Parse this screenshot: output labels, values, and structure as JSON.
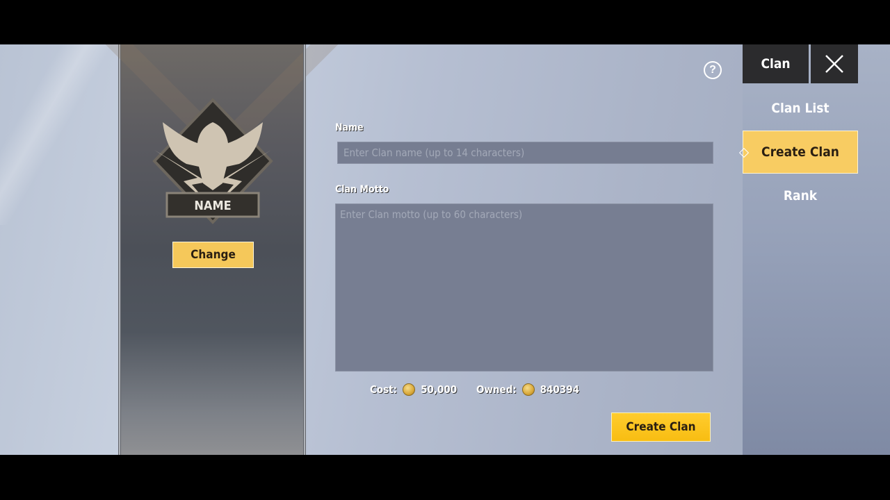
{
  "emblem": {
    "name_plate": "NAME",
    "change_label": "Change"
  },
  "form": {
    "name_label": "Name",
    "name_placeholder": "Enter Clan name (up to 14 characters)",
    "name_value": "",
    "motto_label": "Clan Motto",
    "motto_placeholder": "Enter Clan motto (up to 60 characters)",
    "motto_value": ""
  },
  "cost": {
    "cost_label": "Cost:",
    "cost_value": "50,000",
    "owned_label": "Owned:",
    "owned_value": "840394",
    "currency_icon": "coin-icon"
  },
  "actions": {
    "create_label": "Create Clan",
    "help_icon": "question-circle-icon"
  },
  "sidebar": {
    "tab_label": "Clan",
    "close_icon": "close-icon",
    "items": [
      {
        "label": "Clan List",
        "active": false
      },
      {
        "label": "Create Clan",
        "active": true
      },
      {
        "label": "Rank",
        "active": false
      }
    ]
  },
  "colors": {
    "accent": "#f8cc62",
    "button_primary": "#ffc61e",
    "dark_tab": "#2b2b2d"
  }
}
